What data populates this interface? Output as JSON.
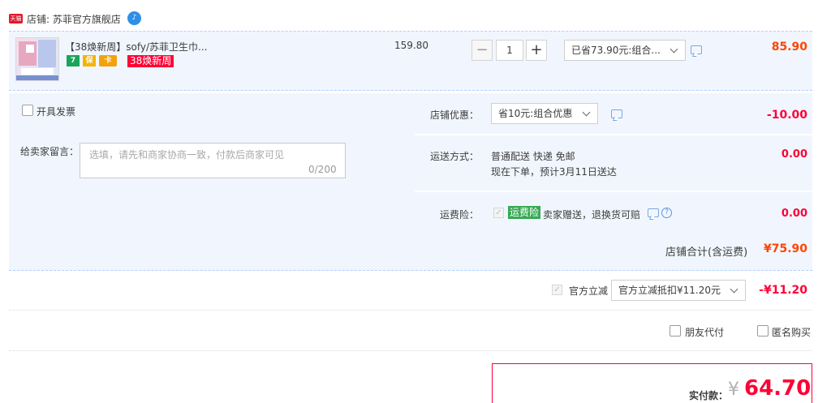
{
  "shop": {
    "badge": "天猫",
    "label": "店铺: 苏菲官方旗舰店"
  },
  "item": {
    "title": "【38焕新周】sofy/苏菲卫生巾...",
    "services": [
      "7",
      "保",
      "卡"
    ],
    "promo_tag": "38焕新周",
    "unit_price": "159.80",
    "quantity": "1",
    "minus": "−",
    "plus": "+",
    "discount_select": "已省73.90元:组合...",
    "total": "85.90"
  },
  "order": {
    "invoice_label": "开具发票",
    "message_label": "给卖家留言：",
    "message_placeholder": "选填，请先和商家协商一致，付款后商家可见",
    "message_count": "0/200",
    "shop_discount_label": "店铺优惠：",
    "shop_discount_select": "省10元:组合优惠",
    "shop_discount_amount": "-10.00",
    "shipping_label": "运送方式：",
    "shipping_method": "普通配送 快递 免邮",
    "shipping_eta": "现在下单，预计3月11日送达",
    "shipping_amount": "0.00",
    "insurance_label": "运费险：",
    "insurance_badge": "运费险",
    "insurance_text": "卖家赠送，退换货可赔",
    "insurance_amount": "0.00"
  },
  "shop_total": {
    "label": "店铺合计(含运费)",
    "value": "¥75.90"
  },
  "official": {
    "label": "官方立减",
    "select": "官方立减抵扣¥11.20元",
    "amount": "-¥11.20"
  },
  "options": {
    "friend_pay": "朋友代付",
    "anonymous": "匿名购买"
  },
  "payment": {
    "label": "实付款：",
    "currency": "¥",
    "amount": "64.70"
  },
  "colors": {
    "accent": "#ff0036",
    "price": "#ff4400",
    "row_bg": "#f1f6fe",
    "tmall": "#e0192b"
  }
}
